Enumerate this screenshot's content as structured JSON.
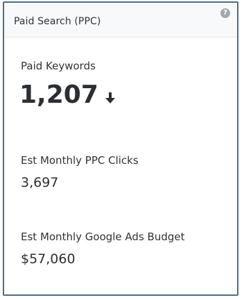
{
  "card": {
    "title": "Paid Search (PPC)",
    "help_icon": "question-circle-icon",
    "help_glyph": "?"
  },
  "metrics": {
    "paid_keywords": {
      "label": "Paid Keywords",
      "value": "1,207",
      "trend_icon": "arrow-down-icon"
    },
    "ppc_clicks": {
      "label": "Est Monthly PPC Clicks",
      "value": "3,697"
    },
    "ads_budget": {
      "label": "Est Monthly Google Ads Budget",
      "value": "$57,060"
    }
  }
}
